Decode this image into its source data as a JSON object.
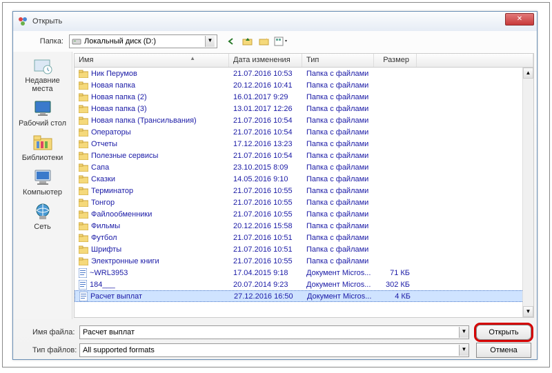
{
  "window": {
    "title": "Открыть"
  },
  "folder_row": {
    "label": "Папка:",
    "combo_text": "Локальный диск (D:)"
  },
  "places": [
    {
      "label": "Недавние места",
      "name": "place-recent"
    },
    {
      "label": "Рабочий стол",
      "name": "place-desktop"
    },
    {
      "label": "Библиотеки",
      "name": "place-libraries"
    },
    {
      "label": "Компьютер",
      "name": "place-computer"
    },
    {
      "label": "Сеть",
      "name": "place-network"
    }
  ],
  "columns": {
    "name": "Имя",
    "date": "Дата изменения",
    "type": "Тип",
    "size": "Размер"
  },
  "rows": [
    {
      "icon": "folder",
      "name": "Ник Перумов",
      "date": "21.07.2016 10:53",
      "type": "Папка с файлами",
      "size": ""
    },
    {
      "icon": "folder",
      "name": "Новая папка",
      "date": "20.12.2016 10:41",
      "type": "Папка с файлами",
      "size": ""
    },
    {
      "icon": "folder",
      "name": "Новая папка (2)",
      "date": "16.01.2017 9:29",
      "type": "Папка с файлами",
      "size": ""
    },
    {
      "icon": "folder",
      "name": "Новая папка (3)",
      "date": "13.01.2017 12:26",
      "type": "Папка с файлами",
      "size": ""
    },
    {
      "icon": "folder",
      "name": "Новая папка (Трансильвания)",
      "date": "21.07.2016 10:54",
      "type": "Папка с файлами",
      "size": ""
    },
    {
      "icon": "folder",
      "name": "Операторы",
      "date": "21.07.2016 10:54",
      "type": "Папка с файлами",
      "size": ""
    },
    {
      "icon": "folder",
      "name": "Отчеты",
      "date": "17.12.2016 13:23",
      "type": "Папка с файлами",
      "size": ""
    },
    {
      "icon": "folder",
      "name": "Полезные сервисы",
      "date": "21.07.2016 10:54",
      "type": "Папка с файлами",
      "size": ""
    },
    {
      "icon": "folder",
      "name": "Сапа",
      "date": "23.10.2015 8:09",
      "type": "Папка с файлами",
      "size": ""
    },
    {
      "icon": "folder",
      "name": "Сказки",
      "date": "14.05.2016 9:10",
      "type": "Папка с файлами",
      "size": ""
    },
    {
      "icon": "folder",
      "name": "Терминатор",
      "date": "21.07.2016 10:55",
      "type": "Папка с файлами",
      "size": ""
    },
    {
      "icon": "folder",
      "name": "Тонгор",
      "date": "21.07.2016 10:55",
      "type": "Папка с файлами",
      "size": ""
    },
    {
      "icon": "folder",
      "name": "Файлообменники",
      "date": "21.07.2016 10:55",
      "type": "Папка с файлами",
      "size": ""
    },
    {
      "icon": "folder",
      "name": "Фильмы",
      "date": "20.12.2016 15:58",
      "type": "Папка с файлами",
      "size": ""
    },
    {
      "icon": "folder",
      "name": "Футбол",
      "date": "21.07.2016 10:51",
      "type": "Папка с файлами",
      "size": ""
    },
    {
      "icon": "folder",
      "name": "Шрифты",
      "date": "21.07.2016 10:51",
      "type": "Папка с файлами",
      "size": ""
    },
    {
      "icon": "folder",
      "name": "Электронные книги",
      "date": "21.07.2016 10:55",
      "type": "Папка с файлами",
      "size": ""
    },
    {
      "icon": "doc",
      "name": "~WRL3953",
      "date": "17.04.2015 9:18",
      "type": "Документ Micros...",
      "size": "71 КБ"
    },
    {
      "icon": "doc",
      "name": "184___",
      "date": "20.07.2014 9:23",
      "type": "Документ Micros...",
      "size": "302 КБ"
    },
    {
      "icon": "doc",
      "name": "Расчет выплат",
      "date": "27.12.2016 16:50",
      "type": "Документ Micros...",
      "size": "4 КБ",
      "selected": true
    }
  ],
  "bottom": {
    "file_label": "Имя файла:",
    "file_value": "Расчет выплат",
    "type_label": "Тип файлов:",
    "type_value": "All supported formats",
    "open_btn": "Открыть",
    "cancel_btn": "Отмена"
  }
}
